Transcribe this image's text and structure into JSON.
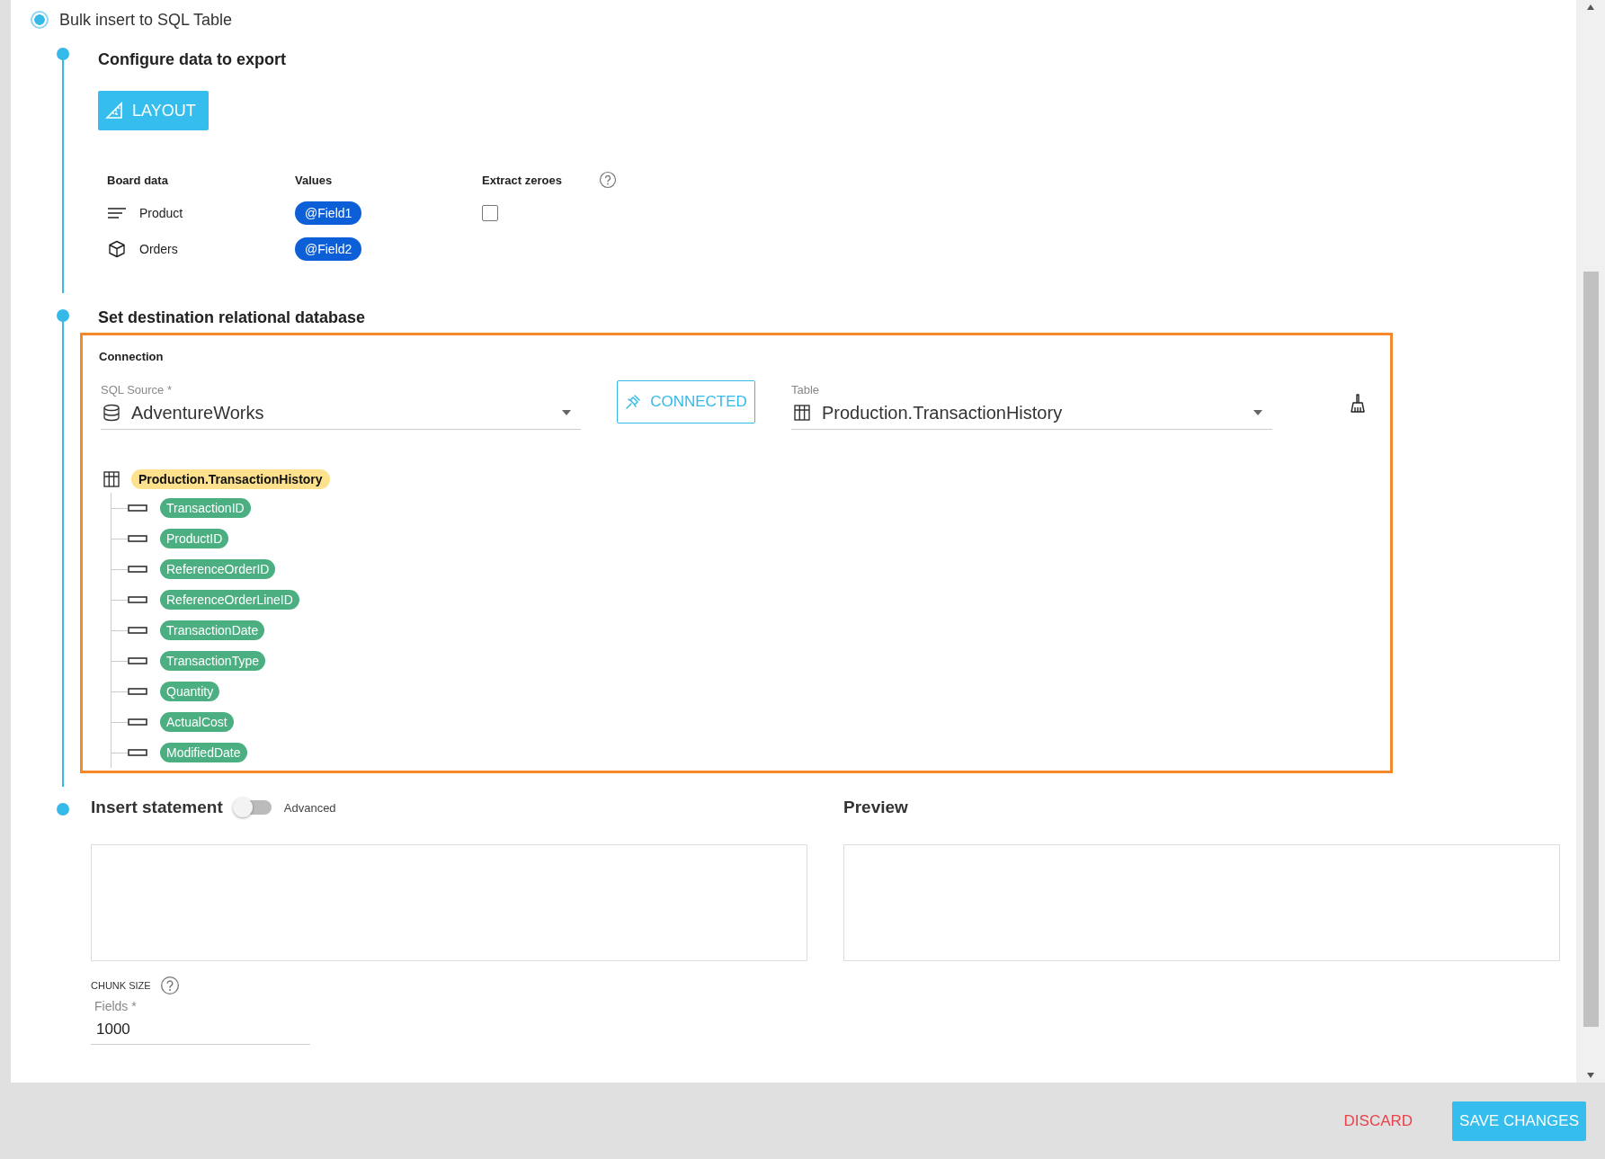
{
  "export_option": {
    "label": "Bulk insert to SQL Table",
    "selected": true
  },
  "configure": {
    "title": "Configure data to export",
    "layout_button": "LAYOUT",
    "columns": [
      "Board data",
      "Values",
      "Extract zeroes"
    ],
    "extract_zeroes": {
      "checked": false
    },
    "rows": [
      {
        "kind": "text",
        "name": "Product",
        "value": "@Field1"
      },
      {
        "kind": "measure",
        "name": "Orders",
        "value": "@Field2"
      }
    ]
  },
  "destination": {
    "title": "Set destination relational database",
    "highlighted": true,
    "heading": "Connection",
    "source_label": "SQL Source *",
    "source_value": "AdventureWorks",
    "status_button": "CONNECTED",
    "table_label": "Table",
    "table_value": "Production.TransactionHistory",
    "tree": {
      "label": "Production.TransactionHistory",
      "children": [
        {
          "label": "TransactionID"
        },
        {
          "label": "ProductID"
        },
        {
          "label": "ReferenceOrderID"
        },
        {
          "label": "ReferenceOrderLineID"
        },
        {
          "label": "TransactionDate"
        },
        {
          "label": "TransactionType"
        },
        {
          "label": "Quantity"
        },
        {
          "label": "ActualCost"
        },
        {
          "label": "ModifiedDate"
        }
      ]
    }
  },
  "insert": {
    "title": "Insert statement",
    "advanced": {
      "label": "Advanced",
      "on": false
    },
    "preview_title": "Preview",
    "chunk_label": "CHUNK SIZE",
    "fields_label": "Fields *",
    "fields_value": "1000"
  },
  "footer": {
    "discard": "DISCARD",
    "save": "SAVE CHANGES"
  }
}
